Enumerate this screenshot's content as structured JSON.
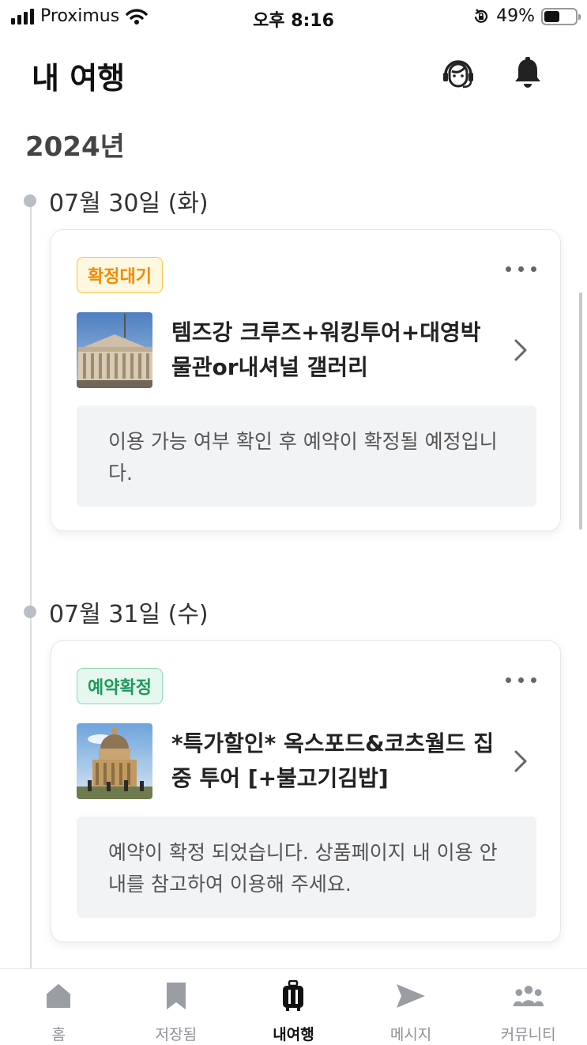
{
  "status_bar": {
    "carrier": "Proximus",
    "time": "오후 8:16",
    "battery_text": "49%",
    "battery_level": 0.49,
    "icons": [
      "signal-icon",
      "wifi-icon",
      "rotation-lock-icon",
      "battery-icon"
    ]
  },
  "header": {
    "title": "내 여행",
    "icons": [
      "customer-support-icon",
      "bell-icon"
    ]
  },
  "timeline": {
    "year": "2024년",
    "groups": [
      {
        "date": "07월 30일 (화)",
        "booking": {
          "status": "확정대기",
          "status_color": "#f08c00",
          "title": "템즈강 크루즈+워킹투어+대영박물관or내셔널 갤러리",
          "notice": "이용 가능 여부 확인 후 예약이 확정될 예정입니다."
        }
      },
      {
        "date": "07월 31일 (수)",
        "booking": {
          "status": "예약확정",
          "status_color": "#1c9a5b",
          "title": "*특가할인* 옥스포드&코츠월드 집중 투어 [+불고기김밥]",
          "notice": "예약이 확정 되었습니다. 상품페이지 내 이용 안내를 참고하여 이용해 주세요."
        }
      }
    ]
  },
  "tab_bar": {
    "tabs": [
      {
        "label": "홈",
        "icon": "home-icon",
        "active": false
      },
      {
        "label": "저장됨",
        "icon": "bookmark-icon",
        "active": false
      },
      {
        "label": "내여행",
        "icon": "suitcase-icon",
        "active": true
      },
      {
        "label": "메시지",
        "icon": "send-icon",
        "active": false
      },
      {
        "label": "커뮤니티",
        "icon": "community-icon",
        "active": false
      }
    ]
  }
}
